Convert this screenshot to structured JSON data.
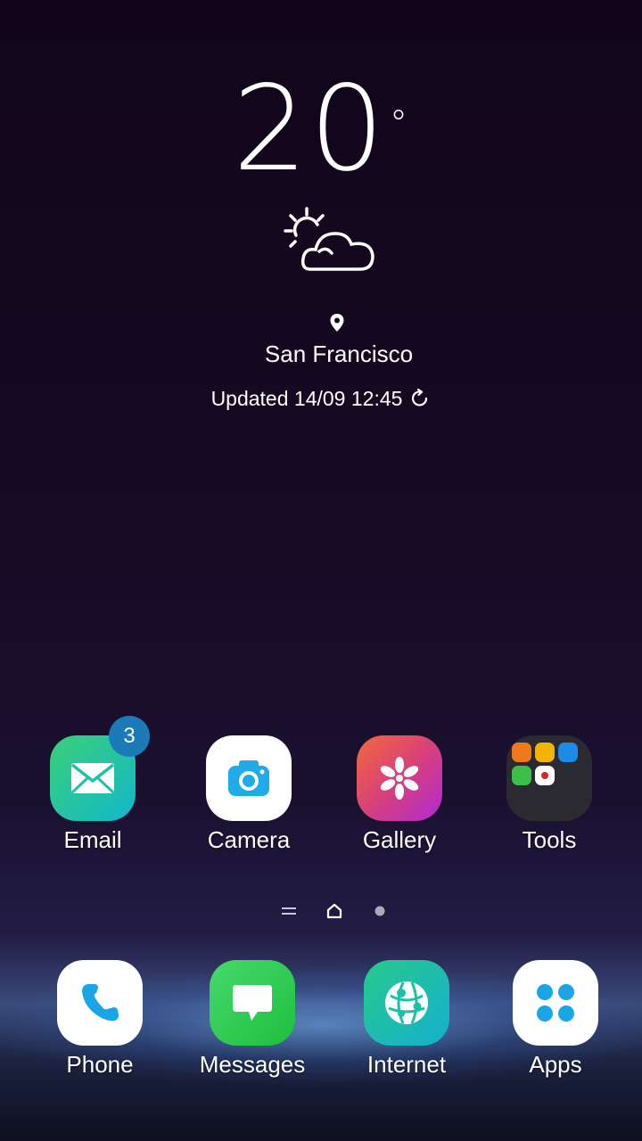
{
  "weather": {
    "temperature": "20",
    "degree_symbol": "°",
    "condition_icon": "partly-cloudy-icon",
    "location_icon": "location-pin-icon",
    "city": "San Francisco",
    "updated_text": "Updated 14/09 12:45",
    "refresh_icon": "refresh-icon"
  },
  "apps": [
    {
      "label": "Email",
      "icon": "email-icon",
      "badge": "3"
    },
    {
      "label": "Camera",
      "icon": "camera-icon"
    },
    {
      "label": "Gallery",
      "icon": "gallery-icon"
    },
    {
      "label": "Tools",
      "icon": "folder-icon"
    }
  ],
  "pager": {
    "apps_icon": "menu-lines-icon",
    "home_icon": "home-icon",
    "page_dot_icon": "page-dot-icon"
  },
  "dock": [
    {
      "label": "Phone",
      "icon": "phone-icon"
    },
    {
      "label": "Messages",
      "icon": "message-icon"
    },
    {
      "label": "Internet",
      "icon": "globe-icon"
    },
    {
      "label": "Apps",
      "icon": "apps-grid-icon"
    }
  ],
  "colors": {
    "email_gradient": [
      "#3ad07a",
      "#12b7c9"
    ],
    "camera_accent": "#1faae8",
    "gallery_gradient": [
      "#f06a3a",
      "#b02ad2"
    ],
    "messages_green": "#2fce53",
    "internet_gradient": [
      "#27c98b",
      "#14b0cf"
    ],
    "apps_blue": "#1aa5e6",
    "badge_blue": "#1b7bb8"
  }
}
